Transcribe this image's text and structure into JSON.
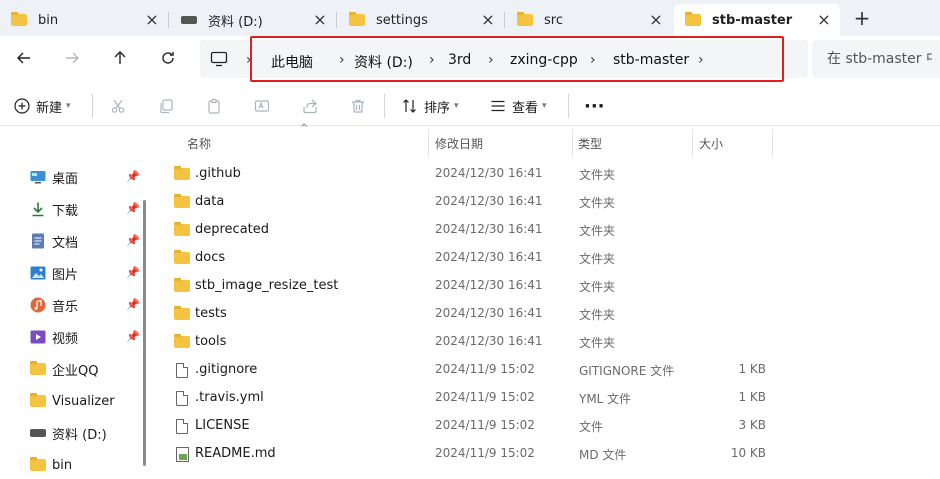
{
  "tabs": [
    {
      "label": "bin",
      "icon": "folder-icon",
      "active": false
    },
    {
      "label": "资料 (D:)",
      "icon": "drive-icon",
      "active": false
    },
    {
      "label": "settings",
      "icon": "folder-icon",
      "active": false
    },
    {
      "label": "src",
      "icon": "folder-icon",
      "active": false
    },
    {
      "label": "stb-master",
      "icon": "folder-icon",
      "active": true
    }
  ],
  "new_tab": "+",
  "breadcrumb": [
    "此电脑",
    "资料 (D:)",
    "3rd",
    "zxing-cpp",
    "stb-master"
  ],
  "search": {
    "placeholder": "在 stb-master 中搜"
  },
  "toolbar": {
    "new_label": "新建",
    "sort_label": "排序",
    "view_label": "查看",
    "more": "···"
  },
  "sidebar": {
    "items": [
      {
        "label": "桌面",
        "icon": "desktop-icon",
        "pinned": true
      },
      {
        "label": "下载",
        "icon": "download-icon",
        "pinned": true
      },
      {
        "label": "文档",
        "icon": "documents-icon",
        "pinned": true
      },
      {
        "label": "图片",
        "icon": "pictures-icon",
        "pinned": true
      },
      {
        "label": "音乐",
        "icon": "music-icon",
        "pinned": true
      },
      {
        "label": "视频",
        "icon": "videos-icon",
        "pinned": true
      },
      {
        "label": "企业QQ",
        "icon": "folder-icon",
        "pinned": false
      },
      {
        "label": "Visualizer",
        "icon": "folder-icon",
        "pinned": false
      },
      {
        "label": "资料 (D:)",
        "icon": "drive-icon",
        "pinned": false
      },
      {
        "label": "bin",
        "icon": "folder-icon",
        "pinned": false
      }
    ]
  },
  "columns": {
    "name": "名称",
    "modified": "修改日期",
    "type": "类型",
    "size": "大小"
  },
  "files": [
    {
      "name": ".github",
      "modified": "2024/12/30 16:41",
      "type": "文件夹",
      "size": "",
      "icon": "folder-icon"
    },
    {
      "name": "data",
      "modified": "2024/12/30 16:41",
      "type": "文件夹",
      "size": "",
      "icon": "folder-icon"
    },
    {
      "name": "deprecated",
      "modified": "2024/12/30 16:41",
      "type": "文件夹",
      "size": "",
      "icon": "folder-icon"
    },
    {
      "name": "docs",
      "modified": "2024/12/30 16:41",
      "type": "文件夹",
      "size": "",
      "icon": "folder-icon"
    },
    {
      "name": "stb_image_resize_test",
      "modified": "2024/12/30 16:41",
      "type": "文件夹",
      "size": "",
      "icon": "folder-icon"
    },
    {
      "name": "tests",
      "modified": "2024/12/30 16:41",
      "type": "文件夹",
      "size": "",
      "icon": "folder-icon"
    },
    {
      "name": "tools",
      "modified": "2024/12/30 16:41",
      "type": "文件夹",
      "size": "",
      "icon": "folder-icon"
    },
    {
      "name": ".gitignore",
      "modified": "2024/11/9 15:02",
      "type": "GITIGNORE 文件",
      "size": "1 KB",
      "icon": "file-icon"
    },
    {
      "name": ".travis.yml",
      "modified": "2024/11/9 15:02",
      "type": "YML 文件",
      "size": "1 KB",
      "icon": "file-icon"
    },
    {
      "name": "LICENSE",
      "modified": "2024/11/9 15:02",
      "type": "文件",
      "size": "3 KB",
      "icon": "file-icon"
    },
    {
      "name": "README.md",
      "modified": "2024/11/9 15:02",
      "type": "MD 文件",
      "size": "10 KB",
      "icon": "markdown-file-icon"
    }
  ]
}
